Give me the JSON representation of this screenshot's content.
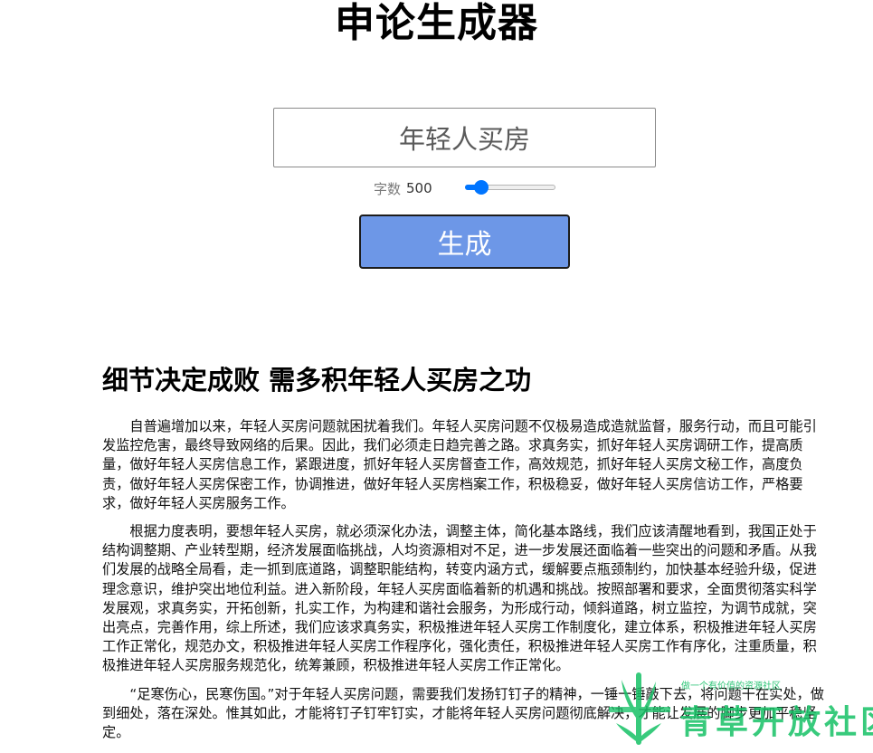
{
  "app": {
    "title": "申论生成器"
  },
  "form": {
    "topic_value": "年轻人买房",
    "word_count_label": "字数",
    "word_count_value": "500",
    "word_count_fraction": 0.12,
    "generate_label": "生成"
  },
  "colors": {
    "button_bg": "#6d97e7",
    "slider_accent": "#0075ff",
    "watermark_green": "#16c166"
  },
  "article": {
    "title": "细节决定成败 需多积年轻人买房之功",
    "paragraphs": [
      "自普遍增加以来，年轻人买房问题就困扰着我们。年轻人买房问题不仅极易造成造就监督，服务行动，而且可能引发监控危害，最终导致网络的后果。因此，我们必须走日趋完善之路。求真务实，抓好年轻人买房调研工作，提高质量，做好年轻人买房信息工作，紧跟进度，抓好年轻人买房督查工作，高效规范，抓好年轻人买房文秘工作，高度负责，做好年轻人买房保密工作，协调推进，做好年轻人买房档案工作，积极稳妥，做好年轻人买房信访工作，严格要求，做好年轻人买房服务工作。",
      "根据力度表明，要想年轻人买房，就必须深化办法，调整主体，简化基本路线，我们应该清醒地看到，我国正处于结构调整期、产业转型期，经济发展面临挑战，人均资源相对不足，进一步发展还面临着一些突出的问题和矛盾。从我们发展的战略全局看，走一抓到底道路，调整职能结构，转变内涵方式，缓解要点瓶颈制约，加快基本经验升级，促进理念意识，维护突出地位利益。进入新阶段，年轻人买房面临着新的机遇和挑战。按照部署和要求，全面贯彻落实科学发展观，求真务实，开拓创新，扎实工作，为构建和谐社会服务，为形成行动，倾斜道路，树立监控，为调节成就，突出亮点，完善作用，综上所述，我们应该求真务实，积极推进年轻人买房工作制度化，建立体系，积极推进年轻人买房工作正常化，规范办文，积极推进年轻人买房工作程序化，强化责任，积极推进年轻人买房工作有序化，注重质量，积极推进年轻人买房服务规范化，统筹兼顾，积极推进年轻人买房工作正常化。",
      "“足寒伤心，民寒伤国。”对于年轻人买房问题，需要我们发扬钉钉子的精神，一锤一锤敲下去，将问题干在实处，做到细处，落在深处。惟其如此，才能将钉子钉牢钉实，才能将年轻人买房问题彻底解决，才能让发展的脚步更加平稳坚定。"
    ]
  },
  "watermark": {
    "tagline": "做一个有价值的资源社区",
    "name": "青草开放社区"
  }
}
